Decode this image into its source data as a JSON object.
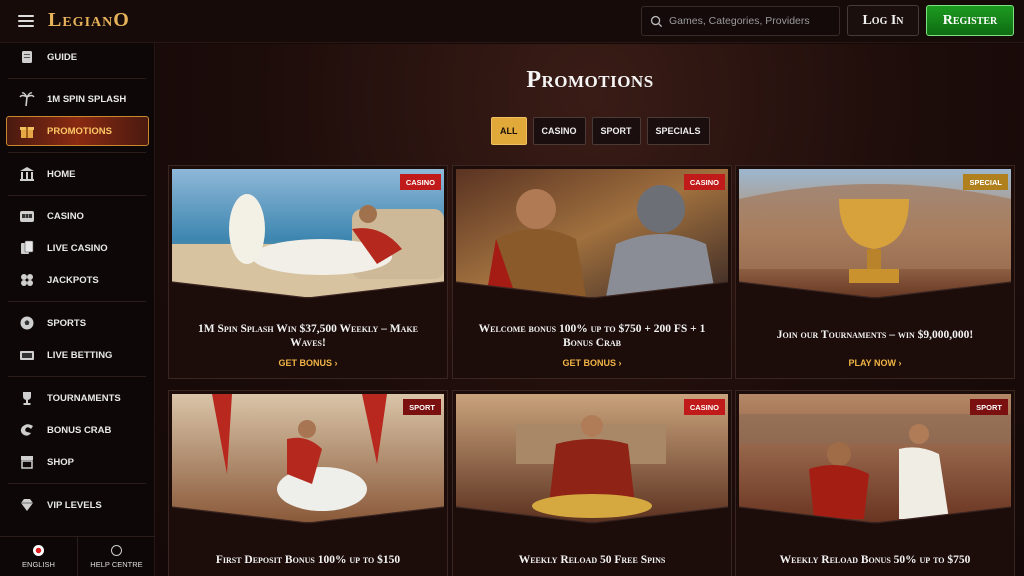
{
  "brand": {
    "logo_text": "LegianO"
  },
  "header": {
    "search_placeholder": "Games, Categories, Providers",
    "login_label": "Log In",
    "register_label": "Register"
  },
  "sidebar": {
    "items": [
      {
        "label": "Guide",
        "icon": "scroll-icon"
      },
      {
        "label": "1M Spin Splash",
        "icon": "palm-tree-icon"
      },
      {
        "label": "Promotions",
        "icon": "gift-icon"
      },
      {
        "label": "Home",
        "icon": "temple-icon"
      },
      {
        "label": "Casino",
        "icon": "slot-machine-icon"
      },
      {
        "label": "Live Casino",
        "icon": "cards-icon"
      },
      {
        "label": "Jackpots",
        "icon": "clover-icon"
      },
      {
        "label": "Sports",
        "icon": "soccer-ball-icon"
      },
      {
        "label": "Live Betting",
        "icon": "live-tv-icon"
      },
      {
        "label": "Tournaments",
        "icon": "trophy-icon"
      },
      {
        "label": "Bonus Crab",
        "icon": "crab-claw-icon"
      },
      {
        "label": "Shop",
        "icon": "shop-icon"
      },
      {
        "label": "VIP Levels",
        "icon": "diamond-icon"
      }
    ],
    "footer": {
      "language_label": "ENGLISH",
      "help_label": "HELP CENTRE"
    }
  },
  "main": {
    "title": "Promotions",
    "filters": [
      "ALL",
      "CASINO",
      "SPORT",
      "SPECIALS"
    ],
    "active_filter": "ALL",
    "cards": [
      {
        "badge": "CASINO",
        "title": "1M Spin Splash Win $37,500 Weekly – Make Waves!",
        "cta": "GET BONUS"
      },
      {
        "badge": "CASINO",
        "title": "Welcome bonus 100% up to $750 + 200 FS + 1 Bonus Crab",
        "cta": "GET BONUS"
      },
      {
        "badge": "SPECIAL",
        "title": "Join our Tournaments – win $9,000,000!",
        "cta": "PLAY NOW"
      },
      {
        "badge": "SPORT",
        "title": "First Deposit Bonus 100% up to $150",
        "cta": ""
      },
      {
        "badge": "CASINO",
        "title": "Weekly Reload 50 Free Spins",
        "cta": ""
      },
      {
        "badge": "SPORT",
        "title": "Weekly Reload Bonus 50% up to $750",
        "cta": ""
      }
    ]
  },
  "colors": {
    "accent": "#e0a93a",
    "register": "#1c9b20",
    "badge_casino": "#c01a1a",
    "badge_sport": "#7a1010",
    "badge_special": "#b0801e"
  }
}
